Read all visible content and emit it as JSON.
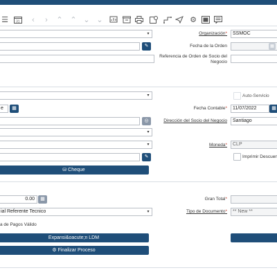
{
  "toolbar": {
    "icons": [
      "menu-icon",
      "calendar-icon",
      "chevron-left-icon",
      "chevron-right-icon",
      "chevron-double-up-icon",
      "chevron-up-icon",
      "chevron-down-icon",
      "chevron-double-down-icon",
      "report-icon",
      "archive-icon",
      "print-icon",
      "product-info-icon",
      "workflow-icon",
      "send-icon",
      "gear-icon",
      "attachment-icon",
      "chat-icon"
    ]
  },
  "row1": {
    "organization_label": "Organización",
    "organization_value": "SSMOC"
  },
  "row2": {
    "order_date_label": "Fecha de la Orden"
  },
  "row3": {
    "bp_order_ref_label": "Referencia de Orden de Socio del Negocio"
  },
  "row5": {
    "self_service_label": "Auto-Servicio"
  },
  "row6": {
    "date_prefix": "e",
    "accounting_date_label": "Fecha Contable",
    "accounting_date_value": "11/07/2022"
  },
  "row7": {
    "bp_address_label": "Dirección del Socio del Negocio",
    "bp_address_value": "Santiago"
  },
  "row8": {
    "currency_label": "Moneda",
    "currency_value": "CLP"
  },
  "row9": {
    "print_discount_label": "Imprimir Descuen"
  },
  "payment": {
    "button_label": "Cheque"
  },
  "totals": {
    "amount_value": "0.00",
    "grand_total_label": "Gran Total"
  },
  "doc": {
    "sales_rep_value": "ial Referente Tecnico",
    "doc_type_label": "Tipo de Documento",
    "doc_type_value": "** New **"
  },
  "payment_schedule": {
    "label": "a de Pagos Válido"
  },
  "actions": {
    "expand_label": "Expansi&oacute;n LDM",
    "finish_label": "Finalizar Proceso"
  }
}
